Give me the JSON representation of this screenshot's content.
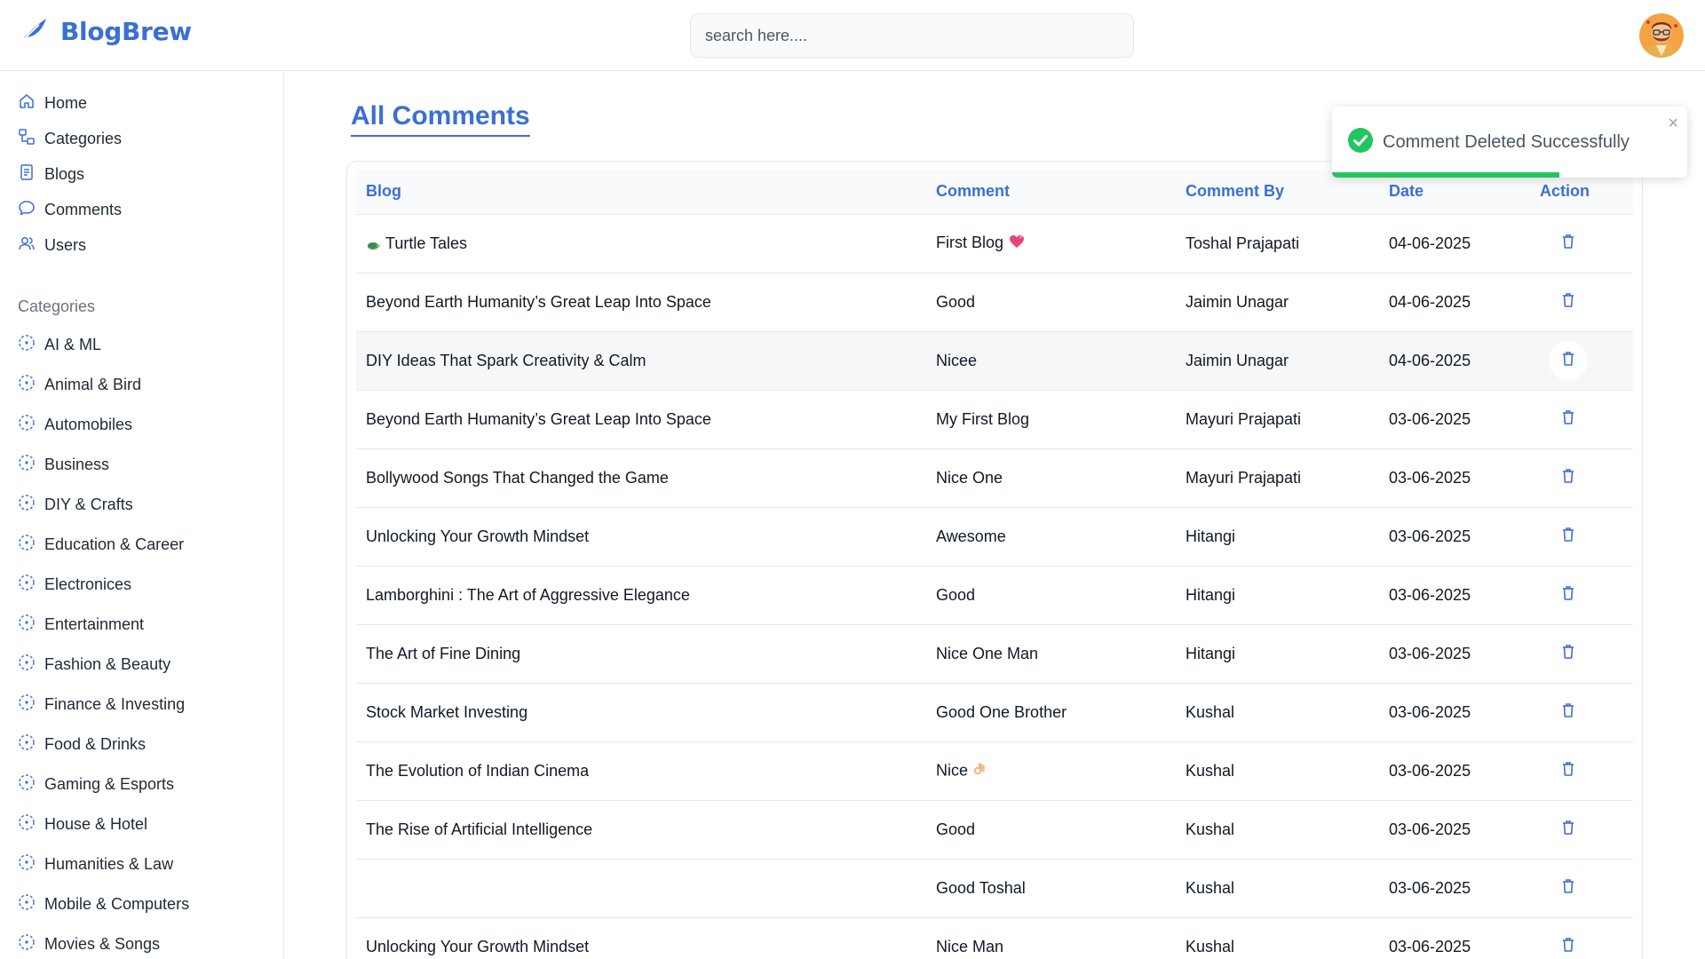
{
  "app": {
    "name": "BlogBrew"
  },
  "search": {
    "placeholder": "search here...."
  },
  "nav": [
    {
      "label": "Home",
      "icon": "home-icon"
    },
    {
      "label": "Categories",
      "icon": "categories-icon"
    },
    {
      "label": "Blogs",
      "icon": "blogs-icon"
    },
    {
      "label": "Comments",
      "icon": "comments-icon"
    },
    {
      "label": "Users",
      "icon": "users-icon"
    }
  ],
  "categories": {
    "heading": "Categories",
    "items": [
      "AI & ML",
      "Animal & Bird",
      "Automobiles",
      "Business",
      "DIY & Crafts",
      "Education & Career",
      "Electronices",
      "Entertainment",
      "Fashion & Beauty",
      "Finance & Investing",
      "Food & Drinks",
      "Gaming & Esports",
      "House & Hotel",
      "Humanities & Law",
      "Mobile & Computers",
      "Movies & Songs"
    ]
  },
  "page": {
    "title": "All Comments"
  },
  "table": {
    "headers": {
      "blog": "Blog",
      "comment": "Comment",
      "by": "Comment By",
      "date": "Date",
      "action": "Action"
    },
    "rows": [
      {
        "blog": "Turtle Tales",
        "comment": "First Blog",
        "by": "Toshal Prajapati",
        "date": "04-06-2025"
      },
      {
        "blog": "Beyond Earth Humanity’s Great Leap Into Space",
        "comment": "Good",
        "by": "Jaimin Unagar",
        "date": "04-06-2025"
      },
      {
        "blog": "DIY Ideas That Spark Creativity & Calm",
        "comment": "Nicee",
        "by": "Jaimin Unagar",
        "date": "04-06-2025"
      },
      {
        "blog": "Beyond Earth Humanity’s Great Leap Into Space",
        "comment": "My First Blog",
        "by": "Mayuri Prajapati",
        "date": "03-06-2025"
      },
      {
        "blog": "Bollywood Songs That Changed the Game",
        "comment": "Nice One",
        "by": "Mayuri Prajapati",
        "date": "03-06-2025"
      },
      {
        "blog": "Unlocking Your Growth Mindset",
        "comment": "Awesome",
        "by": "Hitangi",
        "date": "03-06-2025"
      },
      {
        "blog": "Lamborghini : The Art of Aggressive Elegance",
        "comment": "Good",
        "by": "Hitangi",
        "date": "03-06-2025"
      },
      {
        "blog": "The Art of Fine Dining",
        "comment": "Nice One Man",
        "by": "Hitangi",
        "date": "03-06-2025"
      },
      {
        "blog": "Stock Market Investing",
        "comment": "Good One Brother",
        "by": "Kushal",
        "date": "03-06-2025"
      },
      {
        "blog": "The Evolution of Indian Cinema",
        "comment": "Nice",
        "by": "Kushal",
        "date": "03-06-2025"
      },
      {
        "blog": "The Rise of Artificial Intelligence",
        "comment": "Good",
        "by": "Kushal",
        "date": "03-06-2025"
      },
      {
        "blog": "",
        "comment": "Good Toshal",
        "by": "Kushal",
        "date": "03-06-2025"
      },
      {
        "blog": "Unlocking Your Growth Mindset",
        "comment": "Nice Man",
        "by": "Kushal",
        "date": "03-06-2025"
      }
    ]
  },
  "toast": {
    "message": "Comment Deleted Successfully",
    "close": "×",
    "progress": 0.64
  },
  "colors": {
    "accent": "#3b6fd4",
    "success": "#22c55e",
    "border": "#e5e7eb"
  }
}
